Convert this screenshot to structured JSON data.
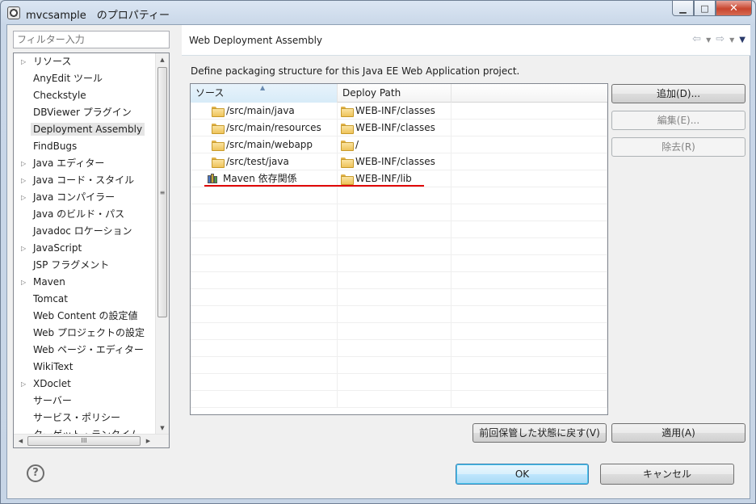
{
  "window": {
    "title": "mvcsample　のプロパティー",
    "controls": {
      "minimize": "▁",
      "maximize": "□",
      "close": "✕"
    }
  },
  "filter": {
    "placeholder": "フィルター入力"
  },
  "sidebar": {
    "items": [
      {
        "label": "リソース",
        "expandable": true
      },
      {
        "label": "AnyEdit ツール",
        "expandable": false
      },
      {
        "label": "Checkstyle",
        "expandable": false
      },
      {
        "label": "DBViewer プラグイン",
        "expandable": false
      },
      {
        "label": "Deployment Assembly",
        "expandable": false,
        "selected": true
      },
      {
        "label": "FindBugs",
        "expandable": false
      },
      {
        "label": "Java エディター",
        "expandable": true
      },
      {
        "label": "Java コード・スタイル",
        "expandable": true
      },
      {
        "label": "Java コンパイラー",
        "expandable": true
      },
      {
        "label": "Java のビルド・パス",
        "expandable": false
      },
      {
        "label": "Javadoc ロケーション",
        "expandable": false
      },
      {
        "label": "JavaScript",
        "expandable": true
      },
      {
        "label": "JSP フラグメント",
        "expandable": false
      },
      {
        "label": "Maven",
        "expandable": true
      },
      {
        "label": "Tomcat",
        "expandable": false
      },
      {
        "label": "Web Content の設定値",
        "expandable": false
      },
      {
        "label": "Web プロジェクトの設定",
        "expandable": false
      },
      {
        "label": "Web ページ・エディター",
        "expandable": false
      },
      {
        "label": "WikiText",
        "expandable": false
      },
      {
        "label": "XDoclet",
        "expandable": true
      },
      {
        "label": "サーバー",
        "expandable": false
      },
      {
        "label": "サービス・ポリシー",
        "expandable": false
      },
      {
        "label": "ターゲット・ランタイム",
        "expandable": false
      }
    ]
  },
  "page": {
    "title": "Web Deployment Assembly",
    "description": "Define packaging structure for this Java EE Web Application project."
  },
  "table": {
    "columns": [
      "ソース",
      "Deploy Path",
      ""
    ],
    "rows": [
      {
        "source": "/src/main/java",
        "path": "WEB-INF/classes",
        "icon": "folder-icon"
      },
      {
        "source": "/src/main/resources",
        "path": "WEB-INF/classes",
        "icon": "folder-icon"
      },
      {
        "source": "/src/main/webapp",
        "path": "/",
        "icon": "folder-icon"
      },
      {
        "source": "/src/test/java",
        "path": "WEB-INF/classes",
        "icon": "folder-icon"
      },
      {
        "source": "Maven 依存関係",
        "path": "WEB-INF/lib",
        "icon": "library-icon"
      }
    ],
    "empty_rows": 13,
    "highlight_color": "#e00000"
  },
  "buttons": {
    "add": "追加(D)...",
    "edit": "編集(E)...",
    "remove": "除去(R)",
    "restore_defaults": "前回保管した状態に戻す(V)",
    "apply": "適用(A)",
    "ok": "OK",
    "cancel": "キャンセル"
  }
}
